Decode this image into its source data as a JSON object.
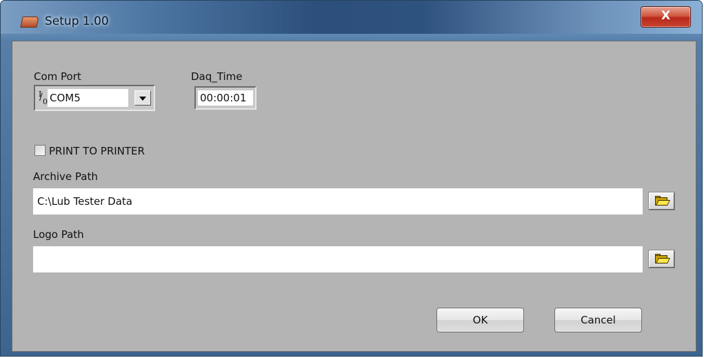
{
  "window": {
    "title": "Setup  1.00",
    "close_label": "X"
  },
  "com_port": {
    "label": "Com Port",
    "io_top": "I",
    "io_bottom": "0",
    "value": "COM5"
  },
  "daq_time": {
    "label": "Daq_Time",
    "value": "00:00:01"
  },
  "print_to_printer": {
    "label": "PRINT TO PRINTER",
    "checked": false
  },
  "archive_path": {
    "label": "Archive Path",
    "value": "C:\\Lub Tester Data"
  },
  "logo_path": {
    "label": "Logo Path",
    "value": ""
  },
  "buttons": {
    "ok": "OK",
    "cancel": "Cancel"
  },
  "icons": [
    "window-app-icon",
    "io-icon",
    "dropdown-arrow-icon",
    "folder-open-icon"
  ],
  "colors": {
    "panel_bg": "#b4b4b4",
    "close_button": "#c8432e",
    "titlebar": "#2c4f7b"
  }
}
